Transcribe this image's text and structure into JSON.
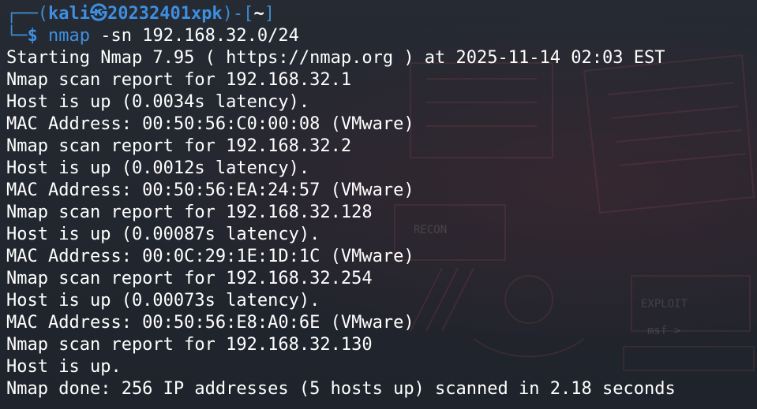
{
  "prompt": {
    "corner_top": "┌──(",
    "user": "kali",
    "skull": "㉿",
    "host": "20232401xpk",
    "sep": ")-[",
    "dir": "~",
    "close": "]",
    "corner_bottom": "└─",
    "dollar": "$",
    "command": "nmap",
    "args": " -sn 192.168.32.0/24"
  },
  "output": [
    "Starting Nmap 7.95 ( https://nmap.org ) at 2025-11-14 02:03 EST",
    "Nmap scan report for 192.168.32.1",
    "Host is up (0.0034s latency).",
    "MAC Address: 00:50:56:C0:00:08 (VMware)",
    "Nmap scan report for 192.168.32.2",
    "Host is up (0.0012s latency).",
    "MAC Address: 00:50:56:EA:24:57 (VMware)",
    "Nmap scan report for 192.168.32.128",
    "Host is up (0.00087s latency).",
    "MAC Address: 00:0C:29:1E:1D:1C (VMware)",
    "Nmap scan report for 192.168.32.254",
    "Host is up (0.00073s latency).",
    "MAC Address: 00:50:56:E8:A0:6E (VMware)",
    "Nmap scan report for 192.168.32.130",
    "Host is up.",
    "Nmap done: 256 IP addresses (5 hosts up) scanned in 2.18 seconds"
  ],
  "wallpaper": {
    "label_recon": "RECON",
    "label_exploit": "EXPLOIT",
    "label_msf": "msf >"
  },
  "colors": {
    "background": "#20242c",
    "prompt_blue": "#3f8fe0",
    "text": "#ffffff"
  }
}
